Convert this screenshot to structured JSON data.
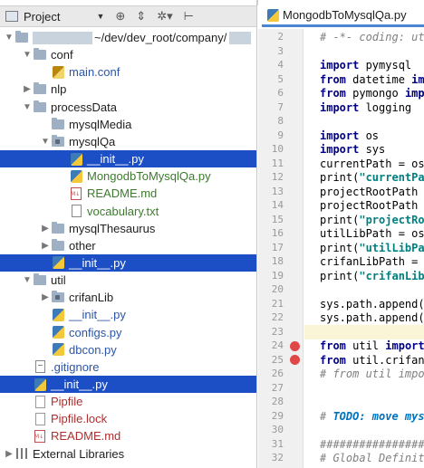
{
  "toolbar": {
    "project_label": "Project",
    "dropdown_glyph": "▼",
    "icons": [
      "target-icon",
      "collapse-icon",
      "gear-icon",
      "hide-icon"
    ]
  },
  "tree": [
    {
      "label": "~/dev/dev_root/company/",
      "indent": 0,
      "arrow": "open",
      "icon": "folder",
      "color": "dark",
      "root": true
    },
    {
      "label": "conf",
      "indent": 1,
      "arrow": "open",
      "icon": "folder",
      "color": "dark"
    },
    {
      "label": "main.conf",
      "indent": 2,
      "arrow": "",
      "icon": "conf",
      "color": "blue"
    },
    {
      "label": "nlp",
      "indent": 1,
      "arrow": "closed",
      "icon": "folder",
      "color": "dark"
    },
    {
      "label": "processData",
      "indent": 1,
      "arrow": "open",
      "icon": "folder",
      "color": "dark"
    },
    {
      "label": "mysqlMedia",
      "indent": 2,
      "arrow": "",
      "icon": "folder",
      "color": "dark"
    },
    {
      "label": "mysqlQa",
      "indent": 2,
      "arrow": "open",
      "icon": "folder-dot",
      "color": "dark"
    },
    {
      "label": "__init__.py",
      "indent": 3,
      "arrow": "",
      "icon": "py",
      "color": "blue",
      "selected": true
    },
    {
      "label": "MongodbToMysqlQa.py",
      "indent": 3,
      "arrow": "",
      "icon": "py",
      "color": "green"
    },
    {
      "label": "README.md",
      "indent": 3,
      "arrow": "",
      "icon": "md",
      "color": "green"
    },
    {
      "label": "vocabulary.txt",
      "indent": 3,
      "arrow": "",
      "icon": "txt",
      "color": "green"
    },
    {
      "label": "mysqlThesaurus",
      "indent": 2,
      "arrow": "closed",
      "icon": "folder",
      "color": "dark"
    },
    {
      "label": "other",
      "indent": 2,
      "arrow": "closed",
      "icon": "folder",
      "color": "dark"
    },
    {
      "label": "__init__.py",
      "indent": 2,
      "arrow": "",
      "icon": "py",
      "color": "blue",
      "selected": true
    },
    {
      "label": "util",
      "indent": 1,
      "arrow": "open",
      "icon": "folder",
      "color": "dark"
    },
    {
      "label": "crifanLib",
      "indent": 2,
      "arrow": "closed",
      "icon": "folder-dot",
      "color": "dark"
    },
    {
      "label": "__init__.py",
      "indent": 2,
      "arrow": "",
      "icon": "py",
      "color": "blue"
    },
    {
      "label": "configs.py",
      "indent": 2,
      "arrow": "",
      "icon": "py",
      "color": "blue"
    },
    {
      "label": "dbcon.py",
      "indent": 2,
      "arrow": "",
      "icon": "py",
      "color": "blue"
    },
    {
      "label": ".gitignore",
      "indent": 1,
      "arrow": "",
      "icon": "gi",
      "color": "blue"
    },
    {
      "label": "__init__.py",
      "indent": 1,
      "arrow": "",
      "icon": "py",
      "color": "blue",
      "selected": true
    },
    {
      "label": "Pipfile",
      "indent": 1,
      "arrow": "",
      "icon": "pipf",
      "color": "red"
    },
    {
      "label": "Pipfile.lock",
      "indent": 1,
      "arrow": "",
      "icon": "pipf",
      "color": "red"
    },
    {
      "label": "README.md",
      "indent": 1,
      "arrow": "",
      "icon": "md",
      "color": "red"
    },
    {
      "label": "External Libraries",
      "indent": 0,
      "arrow": "closed",
      "icon": "lib",
      "color": "dark"
    }
  ],
  "editor": {
    "tab_label": "MongodbToMysqlQa.py",
    "lines": [
      {
        "n": "2",
        "parts": [
          {
            "t": "# -*- coding: utf",
            "c": "cm"
          }
        ]
      },
      {
        "n": "3",
        "parts": []
      },
      {
        "n": "4",
        "parts": [
          {
            "t": "import",
            "c": "k"
          },
          {
            "t": " pymysql",
            "c": ""
          }
        ]
      },
      {
        "n": "5",
        "parts": [
          {
            "t": "from",
            "c": "k"
          },
          {
            "t": " datetime ",
            "c": ""
          },
          {
            "t": "imp",
            "c": "k"
          }
        ]
      },
      {
        "n": "6",
        "parts": [
          {
            "t": "from",
            "c": "k"
          },
          {
            "t": " pymongo ",
            "c": ""
          },
          {
            "t": "impo",
            "c": "k"
          }
        ]
      },
      {
        "n": "7",
        "parts": [
          {
            "t": "import",
            "c": "k"
          },
          {
            "t": " logging",
            "c": ""
          }
        ]
      },
      {
        "n": "8",
        "parts": []
      },
      {
        "n": "9",
        "parts": [
          {
            "t": "import",
            "c": "k"
          },
          {
            "t": " os",
            "c": ""
          }
        ]
      },
      {
        "n": "10",
        "parts": [
          {
            "t": "import",
            "c": "k"
          },
          {
            "t": " sys",
            "c": ""
          }
        ]
      },
      {
        "n": "11",
        "parts": [
          {
            "t": "currentPath = os.",
            "c": ""
          }
        ]
      },
      {
        "n": "12",
        "parts": [
          {
            "t": "print(",
            "c": ""
          },
          {
            "t": "\"currentPat",
            "c": "s"
          }
        ]
      },
      {
        "n": "13",
        "parts": [
          {
            "t": "projectRootPath =",
            "c": ""
          }
        ]
      },
      {
        "n": "14",
        "parts": [
          {
            "t": "projectRootPath =",
            "c": ""
          }
        ]
      },
      {
        "n": "15",
        "parts": [
          {
            "t": "print(",
            "c": ""
          },
          {
            "t": "\"projectRoo",
            "c": "s"
          }
        ]
      },
      {
        "n": "16",
        "parts": [
          {
            "t": "utilLibPath = os.",
            "c": ""
          }
        ]
      },
      {
        "n": "17",
        "parts": [
          {
            "t": "print(",
            "c": ""
          },
          {
            "t": "\"utilLibPat",
            "c": "s"
          }
        ]
      },
      {
        "n": "18",
        "parts": [
          {
            "t": "crifanLibPath = c",
            "c": ""
          }
        ]
      },
      {
        "n": "19",
        "parts": [
          {
            "t": "print(",
            "c": ""
          },
          {
            "t": "\"crifanLibP",
            "c": "s"
          }
        ]
      },
      {
        "n": "20",
        "parts": []
      },
      {
        "n": "21",
        "parts": [
          {
            "t": "sys.path.append(p",
            "c": ""
          }
        ]
      },
      {
        "n": "22",
        "parts": [
          {
            "t": "sys.path.append(c",
            "c": ""
          }
        ]
      },
      {
        "n": "23",
        "parts": [],
        "highlight": true
      },
      {
        "n": "24",
        "parts": [
          {
            "t": "from",
            "c": "k"
          },
          {
            "t": " util ",
            "c": ""
          },
          {
            "t": "import",
            "c": "k"
          }
        ],
        "breakpoint": true
      },
      {
        "n": "25",
        "parts": [
          {
            "t": "from",
            "c": "k"
          },
          {
            "t": " util.crifanL",
            "c": ""
          }
        ],
        "breakpoint": true
      },
      {
        "n": "26",
        "parts": [
          {
            "t": "# from util impor",
            "c": "cm"
          }
        ]
      },
      {
        "n": "27",
        "parts": []
      },
      {
        "n": "28",
        "parts": []
      },
      {
        "n": "29",
        "parts": [
          {
            "t": "# ",
            "c": "cm"
          },
          {
            "t": "TODO: move mysq",
            "c": "todo"
          }
        ]
      },
      {
        "n": "30",
        "parts": []
      },
      {
        "n": "31",
        "parts": [
          {
            "t": "#################",
            "c": "cm"
          }
        ]
      },
      {
        "n": "32",
        "parts": [
          {
            "t": "# Global Definiti",
            "c": "cm"
          }
        ]
      }
    ]
  }
}
